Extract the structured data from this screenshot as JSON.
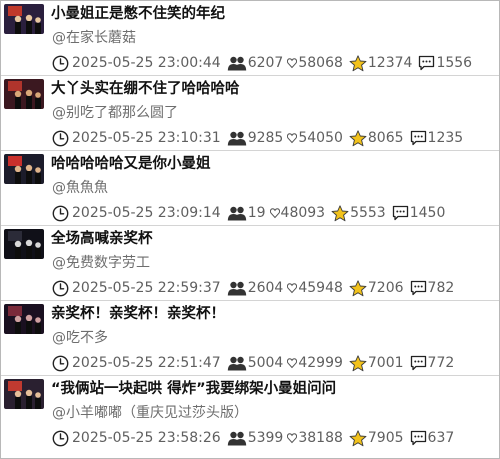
{
  "icons": {
    "time": "clock-icon",
    "viewers": "people-icon",
    "likes": "heart-icon",
    "favorites": "star-icon",
    "comments": "comment-icon"
  },
  "colors": {
    "title": "#111111",
    "secondary": "#6e6e6e",
    "star": "#f2c21b",
    "divider": "#d4d4d4"
  },
  "items": [
    {
      "title": "小曼姐正是憋不住笑的年纪",
      "author": "@在家长蘑菇",
      "time": "2025-05-25 23:00:44",
      "viewers": "6207",
      "likes": "58068",
      "favorites": "12374",
      "comments": "1556",
      "thumb_colors": [
        "#2a1f3d",
        "#c0392b",
        "#e8c8a0"
      ]
    },
    {
      "title": "大丫头实在绷不住了哈哈哈哈",
      "author": "@别吃了都那么圆了",
      "time": "2025-05-25 23:10:31",
      "viewers": "9285",
      "likes": "54050",
      "favorites": "8065",
      "comments": "1235",
      "thumb_colors": [
        "#3b1820",
        "#b0342c",
        "#d9a878"
      ]
    },
    {
      "title": "哈哈哈哈哈又是你小曼姐",
      "author": "@魚魚魚",
      "time": "2025-05-25 23:09:14",
      "viewers": "19",
      "likes": "48093",
      "favorites": "5553",
      "comments": "1450",
      "thumb_colors": [
        "#1c1c2a",
        "#c9302c",
        "#e0b48a"
      ]
    },
    {
      "title": "全场高喊亲奖杯",
      "author": "@免费数字劳工",
      "time": "2025-05-25 22:59:37",
      "viewers": "2604",
      "likes": "45948",
      "favorites": "7206",
      "comments": "782",
      "thumb_colors": [
        "#101018",
        "#2b2b38",
        "#d8d8d8"
      ]
    },
    {
      "title": "亲奖杯！亲奖杯！亲奖杯！",
      "author": "@吃不多",
      "time": "2025-05-25 22:51:47",
      "viewers": "5004",
      "likes": "42999",
      "favorites": "7001",
      "comments": "772",
      "thumb_colors": [
        "#1a1020",
        "#7a2a3a",
        "#cfa0a0"
      ]
    },
    {
      "title": "“我俩站一块起哄 得炸”我要绑架小曼姐问问",
      "author": "@小羊嘟嘟（重庆见过莎头版）",
      "time": "2025-05-25 23:58:26",
      "viewers": "5399",
      "likes": "38188",
      "favorites": "7905",
      "comments": "637",
      "thumb_colors": [
        "#2a2030",
        "#c03a30",
        "#e6c09a"
      ]
    }
  ]
}
